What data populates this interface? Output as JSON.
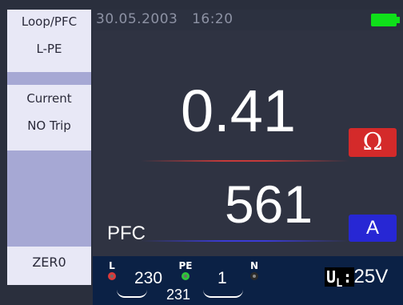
{
  "menu": {
    "loop_pfc": "Loop/PFC",
    "l_pe": "L-PE",
    "current": "Current",
    "no_trip": "NO Trip",
    "zero": "ZER0"
  },
  "status": {
    "date": "30.05.2003",
    "time": "16:20"
  },
  "measurement": {
    "main_value": "0.41",
    "main_unit": "Ω",
    "pfc_label": "PFC",
    "pfc_value": "561",
    "pfc_unit": "A"
  },
  "terminals": {
    "L_label": "L",
    "PE_label": "PE",
    "N_label": "N",
    "v_L_PE": "230",
    "v_PE_N": "1",
    "v_L_N": "231"
  },
  "limit": {
    "ul_label": "U",
    "ul_sub": "L",
    "ul_value": "25V"
  },
  "colors": {
    "ohm_badge": "#d42a2a",
    "amp_badge": "#2727d4",
    "battery": "#0fe01a",
    "menu_bg": "#a6a8d4",
    "menu_item": "#e8e8f6"
  },
  "icons": {
    "battery": "battery-full-icon"
  }
}
